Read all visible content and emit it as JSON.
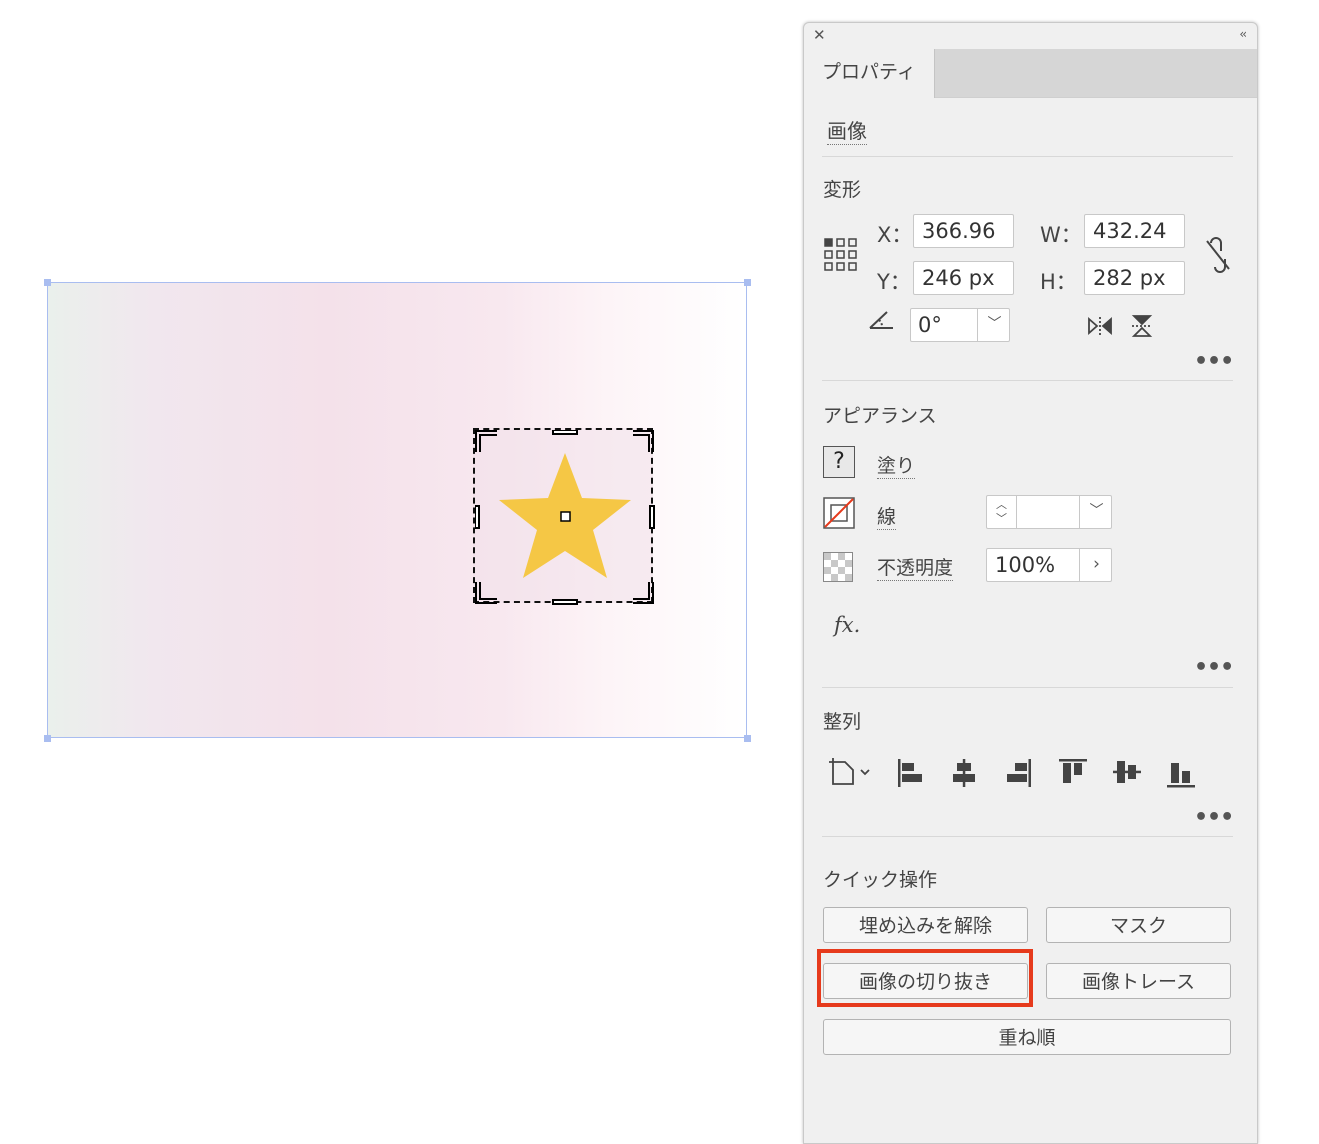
{
  "panel": {
    "tab_label": "プロパティ",
    "object_type": "画像"
  },
  "transform": {
    "title": "変形",
    "x_label": "X：",
    "x_value": "366.96",
    "y_label": "Y：",
    "y_value": "246 px",
    "w_label": "W：",
    "w_value": "432.24",
    "h_label": "H：",
    "h_value": "282 px",
    "angle_value": "0°"
  },
  "appearance": {
    "title": "アピアランス",
    "fill_label": "塗り",
    "stroke_label": "線",
    "opacity_label": "不透明度",
    "opacity_value": "100%",
    "fill_swatch": "?",
    "fx_label": "fx."
  },
  "align": {
    "title": "整列"
  },
  "quick_actions": {
    "title": "クイック操作",
    "unembed": "埋め込みを解除",
    "mask": "マスク",
    "crop": "画像の切り抜き",
    "trace": "画像トレース",
    "arrange": "重ね順"
  },
  "colors": {
    "highlight": "#e63a1c",
    "star": "#f5c745",
    "selection": "#a9bdf0"
  }
}
